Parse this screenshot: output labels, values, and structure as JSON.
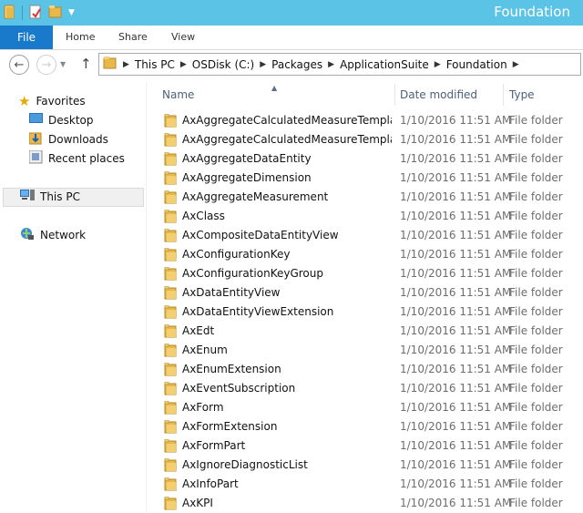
{
  "window": {
    "title": "Foundation"
  },
  "ribbon": {
    "file_tab": "File",
    "tabs": [
      "Home",
      "Share",
      "View"
    ]
  },
  "address": {
    "crumbs": [
      "This PC",
      "OSDisk (C:)",
      "Packages",
      "ApplicationSuite",
      "Foundation"
    ]
  },
  "sidebar": {
    "favorites": "Favorites",
    "desktop": "Desktop",
    "downloads": "Downloads",
    "recent": "Recent places",
    "thispc": "This PC",
    "network": "Network"
  },
  "columns": {
    "name": "Name",
    "date": "Date modified",
    "type": "Type"
  },
  "files": [
    {
      "name": "AxAggregateCalculatedMeasureTemplate",
      "date": "1/10/2016 11:51 AM",
      "type": "File folder"
    },
    {
      "name": "AxAggregateCalculatedMeasureTemplat...",
      "date": "1/10/2016 11:51 AM",
      "type": "File folder"
    },
    {
      "name": "AxAggregateDataEntity",
      "date": "1/10/2016 11:51 AM",
      "type": "File folder"
    },
    {
      "name": "AxAggregateDimension",
      "date": "1/10/2016 11:51 AM",
      "type": "File folder"
    },
    {
      "name": "AxAggregateMeasurement",
      "date": "1/10/2016 11:51 AM",
      "type": "File folder"
    },
    {
      "name": "AxClass",
      "date": "1/10/2016 11:51 AM",
      "type": "File folder"
    },
    {
      "name": "AxCompositeDataEntityView",
      "date": "1/10/2016 11:51 AM",
      "type": "File folder"
    },
    {
      "name": "AxConfigurationKey",
      "date": "1/10/2016 11:51 AM",
      "type": "File folder"
    },
    {
      "name": "AxConfigurationKeyGroup",
      "date": "1/10/2016 11:51 AM",
      "type": "File folder"
    },
    {
      "name": "AxDataEntityView",
      "date": "1/10/2016 11:51 AM",
      "type": "File folder"
    },
    {
      "name": "AxDataEntityViewExtension",
      "date": "1/10/2016 11:51 AM",
      "type": "File folder"
    },
    {
      "name": "AxEdt",
      "date": "1/10/2016 11:51 AM",
      "type": "File folder"
    },
    {
      "name": "AxEnum",
      "date": "1/10/2016 11:51 AM",
      "type": "File folder"
    },
    {
      "name": "AxEnumExtension",
      "date": "1/10/2016 11:51 AM",
      "type": "File folder"
    },
    {
      "name": "AxEventSubscription",
      "date": "1/10/2016 11:51 AM",
      "type": "File folder"
    },
    {
      "name": "AxForm",
      "date": "1/10/2016 11:51 AM",
      "type": "File folder"
    },
    {
      "name": "AxFormExtension",
      "date": "1/10/2016 11:51 AM",
      "type": "File folder"
    },
    {
      "name": "AxFormPart",
      "date": "1/10/2016 11:51 AM",
      "type": "File folder"
    },
    {
      "name": "AxIgnoreDiagnosticList",
      "date": "1/10/2016 11:51 AM",
      "type": "File folder"
    },
    {
      "name": "AxInfoPart",
      "date": "1/10/2016 11:51 AM",
      "type": "File folder"
    },
    {
      "name": "AxKPI",
      "date": "1/10/2016 11:51 AM",
      "type": "File folder"
    }
  ],
  "colors": {
    "titlebar": "#5bc3e6",
    "file_tab": "#1979ca",
    "folder": "#e8b84a"
  }
}
